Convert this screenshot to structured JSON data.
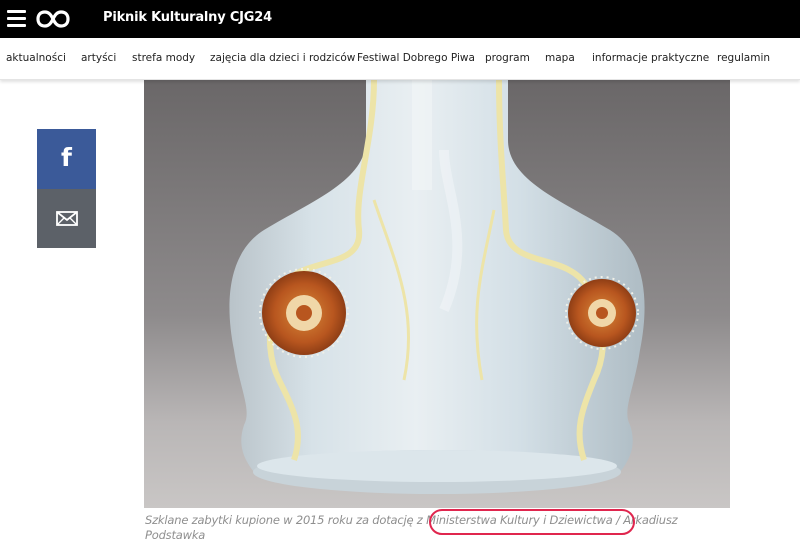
{
  "header": {
    "site_title": "Piknik Kulturalny CJG24",
    "menu_icon": "hamburger-menu-icon",
    "logo_icon": "infinity-logo-icon"
  },
  "nav": {
    "items": [
      {
        "label": "aktualności"
      },
      {
        "label": "artyści"
      },
      {
        "label": "strefa mody"
      },
      {
        "label": "zajęcia dla dzieci i rodziców"
      },
      {
        "label": "Festiwal Dobrego Piwa"
      },
      {
        "label": "program"
      },
      {
        "label": "mapa"
      },
      {
        "label": "informacje praktyczne"
      },
      {
        "label": "regulamin"
      }
    ]
  },
  "share": {
    "facebook_glyph": "f",
    "facebook_icon": "facebook-icon",
    "mail_icon": "envelope-icon"
  },
  "article": {
    "image_subject": "opalescent glass vase with poppy ornaments",
    "caption_before": "Szklane zabytki kupione w 2015 roku za dotację z ",
    "caption_highlight": "Ministerstwa Kultury i Dziewictwa",
    "caption_after": " / Arkadiusz Podstawka"
  },
  "colors": {
    "topbar": "#000000",
    "facebook": "#3b5a99",
    "mail": "#5c6168",
    "highlight": "#e0264e",
    "caption": "#8f8f8f"
  }
}
